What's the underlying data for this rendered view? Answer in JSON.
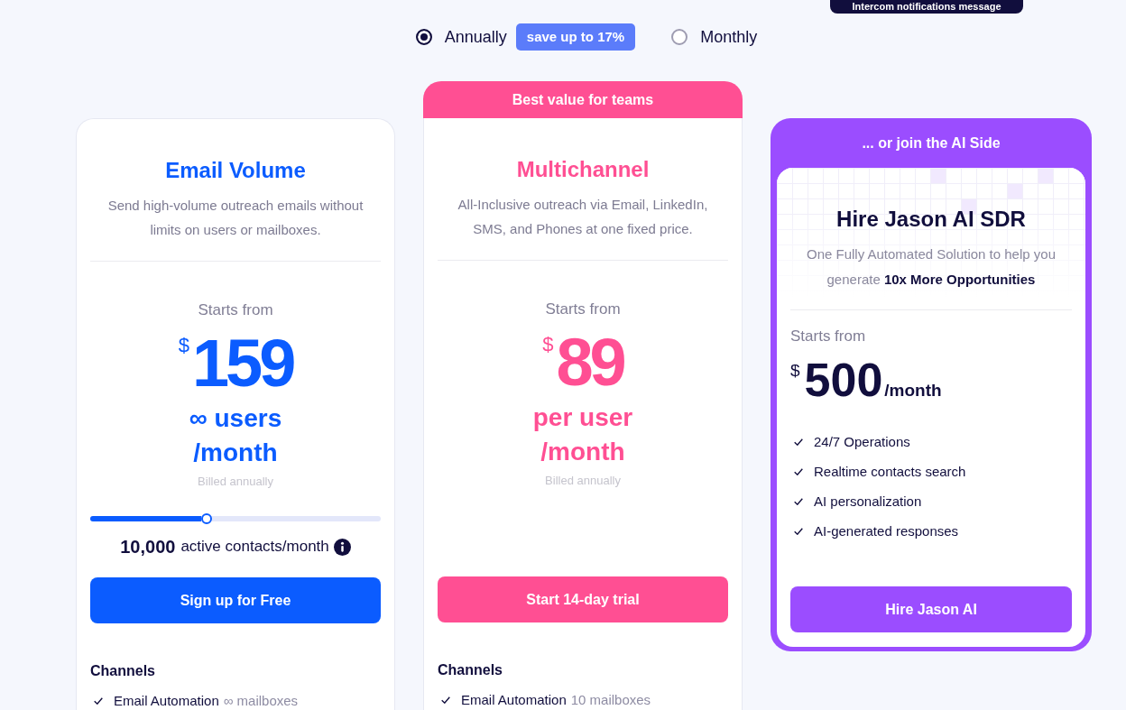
{
  "notification": {
    "text": "Intercom notifications message"
  },
  "billing_toggle": {
    "options": [
      {
        "label": "Annually",
        "selected": true,
        "badge": "save up to 17%"
      },
      {
        "label": "Monthly",
        "selected": false
      }
    ]
  },
  "plans": [
    {
      "kind": "standard",
      "color": "#0b5cff",
      "title": "Email Volume",
      "description": "Send high-volume outreach emails without limits on users or mailboxes.",
      "price_label": "Starts from",
      "currency": "$",
      "amount": "159",
      "unit": "∞ users /month",
      "billing_note": "Billed annually",
      "slider": {
        "level": 0.4,
        "count": "10,000",
        "label": "active contacts/month"
      },
      "button": "Sign up for Free",
      "section": "Channels",
      "features": [
        {
          "label": "Email Automation",
          "detail": "∞ mailboxes"
        }
      ]
    },
    {
      "kind": "standard",
      "color": "#ff4f93",
      "ribbon": "Best value for teams",
      "title": "Multichannel",
      "description": "All-Inclusive outreach via Email, LinkedIn, SMS, and Phones at one fixed price.",
      "price_label": "Starts from",
      "currency": "$",
      "amount": "89",
      "unit": "per user /month",
      "billing_note": "Billed annually",
      "button": "Start 14-day trial",
      "section": "Channels",
      "features": [
        {
          "label": "Email Automation",
          "detail": "10 mailboxes"
        }
      ]
    },
    {
      "kind": "ai",
      "color": "#9b4dff",
      "banner": "... or join the AI Side",
      "title": "Hire Jason AI SDR",
      "description": "One Fully Automated Solution to help you generate **10x More Opportunities**",
      "price_label": "Starts from",
      "currency": "$",
      "amount": "500",
      "unit": "/month",
      "features": [
        "24/7 Operations",
        "Realtime contacts search",
        "AI personalization",
        "AI-generated responses"
      ],
      "button": "Hire Jason AI"
    }
  ]
}
